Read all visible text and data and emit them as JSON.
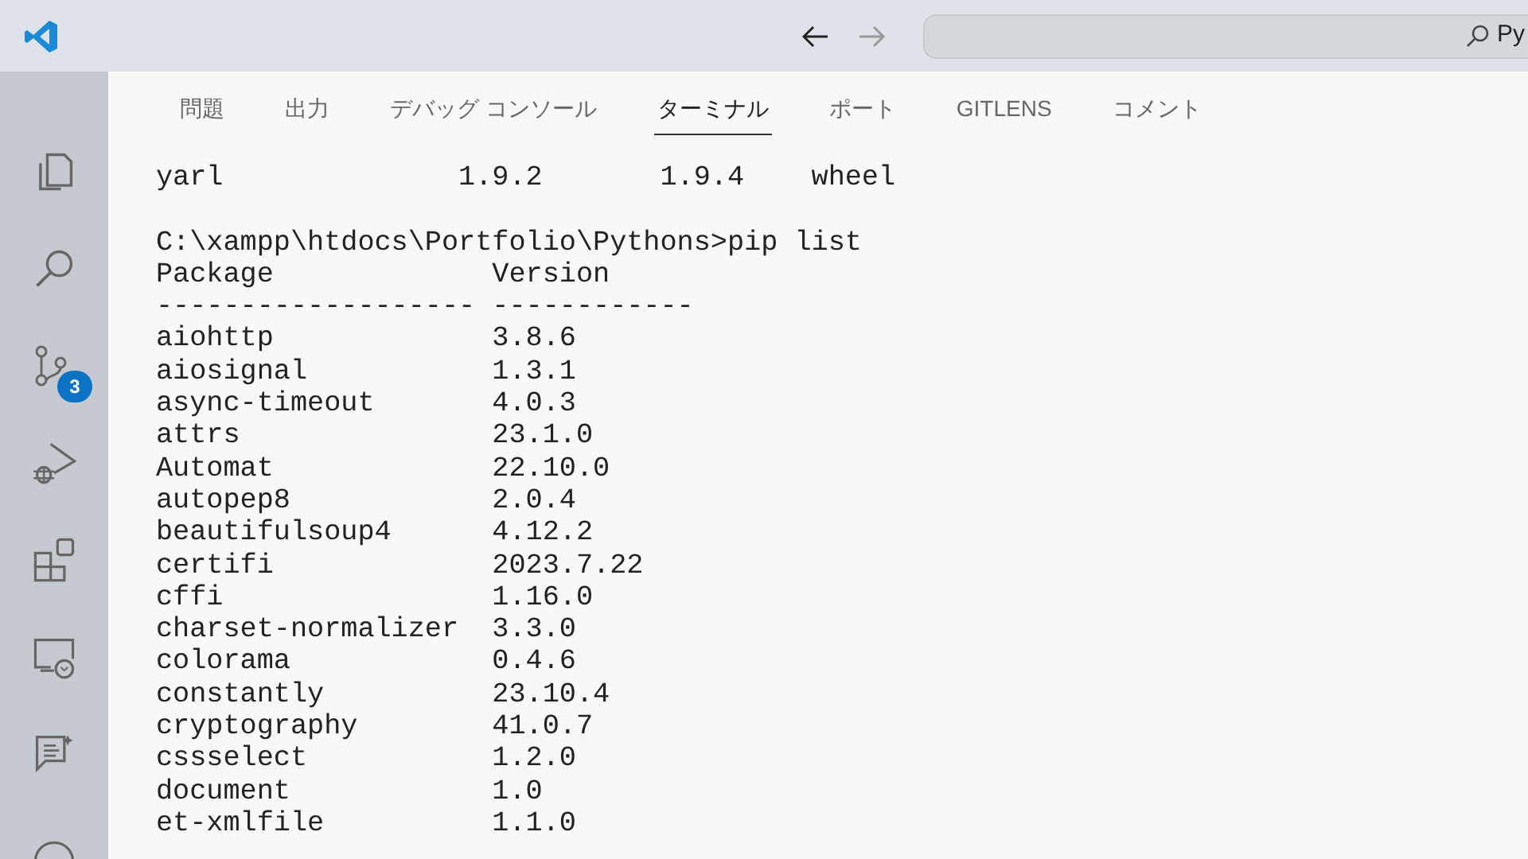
{
  "title_bar": {
    "search": {
      "value": "Py"
    }
  },
  "activity_bar": {
    "items": [
      {
        "kind": "files"
      },
      {
        "kind": "search"
      },
      {
        "kind": "source-control",
        "badge": "3"
      },
      {
        "kind": "debug"
      },
      {
        "kind": "extensions"
      },
      {
        "kind": "remote"
      },
      {
        "kind": "chat"
      },
      {
        "kind": "account"
      }
    ]
  },
  "panel": {
    "tabs": [
      {
        "label": "問題",
        "selected": false
      },
      {
        "label": "出力",
        "selected": false
      },
      {
        "label": "デバッグ コンソール",
        "selected": false
      },
      {
        "label": "ターミナル",
        "selected": true
      },
      {
        "label": "ポート",
        "selected": false
      },
      {
        "label": "GITLENS",
        "selected": false
      },
      {
        "label": "コメント",
        "selected": false
      }
    ]
  },
  "terminal": {
    "blocks": [
      [
        "yarl              1.9.2       1.9.4    wheel"
      ],
      [
        "C:\\xampp\\htdocs\\Portfolio\\Pythons>pip list",
        "Package             Version",
        "------------------- ------------",
        "aiohttp             3.8.6",
        "aiosignal           1.3.1",
        "async-timeout       4.0.3",
        "attrs               23.1.0",
        "Automat             22.10.0",
        "autopep8            2.0.4",
        "beautifulsoup4      4.12.2",
        "certifi             2023.7.22",
        "cffi                1.16.0",
        "charset-normalizer  3.3.0",
        "colorama            0.4.6",
        "constantly          23.10.4",
        "cryptography        41.0.7",
        "cssselect           1.2.0",
        "document            1.0",
        "et-xmlfile          1.1.0"
      ]
    ]
  }
}
